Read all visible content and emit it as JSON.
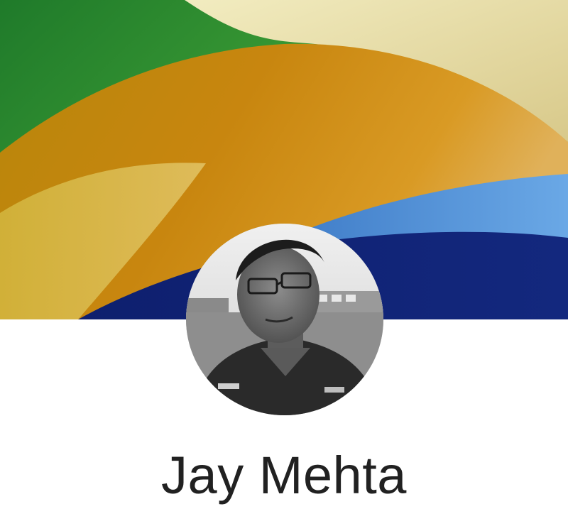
{
  "profile": {
    "name": "Jay Mehta"
  },
  "colors": {
    "cover_green": "#2e8b2f",
    "cover_cream": "#ece6b4",
    "cover_gold": "#c28c12",
    "cover_blue_light": "#4b8fd6",
    "cover_navy": "#10237a",
    "name_text": "#212121",
    "background": "#ffffff"
  }
}
